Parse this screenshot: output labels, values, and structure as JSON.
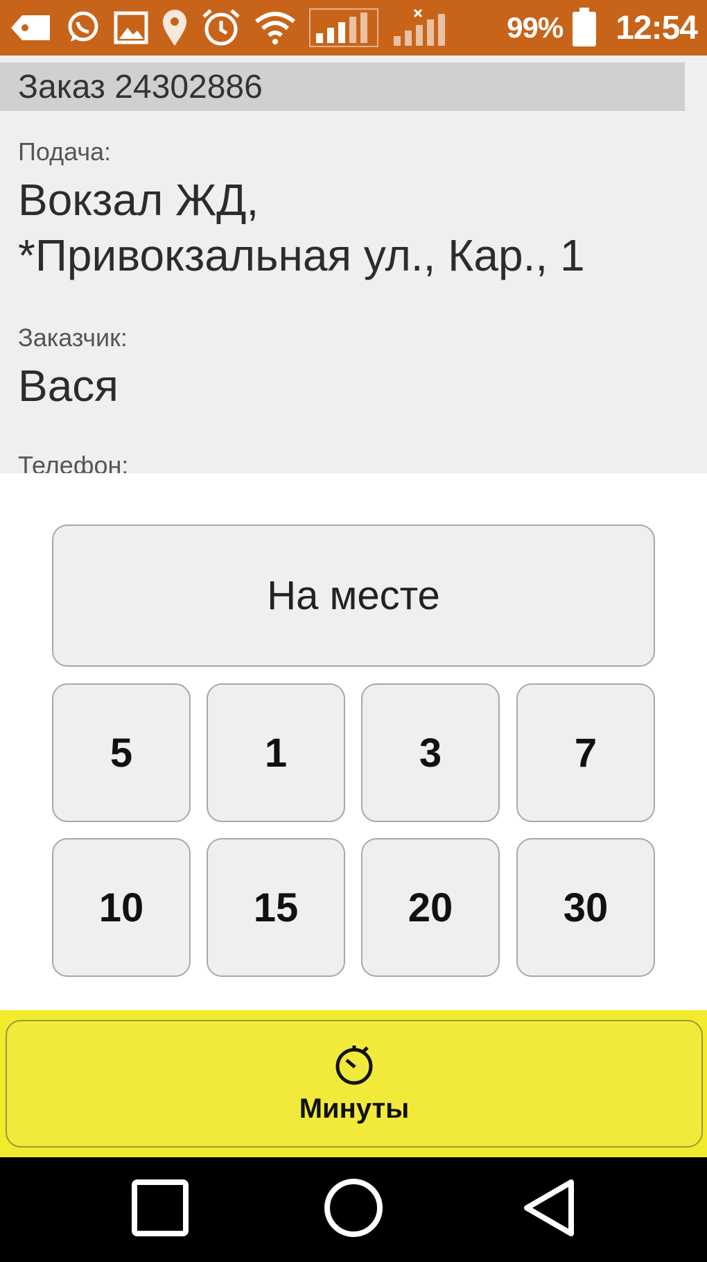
{
  "status_bar": {
    "battery_text": "99%",
    "time": "12:54",
    "icons": [
      "tag-icon",
      "whatsapp-icon",
      "gallery-icon",
      "location-icon",
      "alarm-icon",
      "wifi-icon",
      "signal-icon",
      "signal-no-sim-icon",
      "battery-icon"
    ],
    "color": "#c8641a"
  },
  "order": {
    "title": "Заказ 24302886",
    "pickup_label": "Подача:",
    "pickup_line1": "Вокзал ЖД,",
    "pickup_line2": "*Привокзальная ул., Кар., 1",
    "customer_label": "Заказчик:",
    "customer_value": "Вася",
    "phone_label": "Телефон:"
  },
  "actions": {
    "on_site_label": "На месте",
    "minute_buttons": [
      "5",
      "1",
      "3",
      "7",
      "10",
      "15",
      "20",
      "30"
    ]
  },
  "bottom": {
    "minutes_label": "Минуты",
    "minutes_icon": "timer-icon",
    "accent_color": "#f2ea2c"
  },
  "nav": {
    "icons": [
      "recent-apps-icon",
      "home-icon",
      "back-icon"
    ]
  }
}
